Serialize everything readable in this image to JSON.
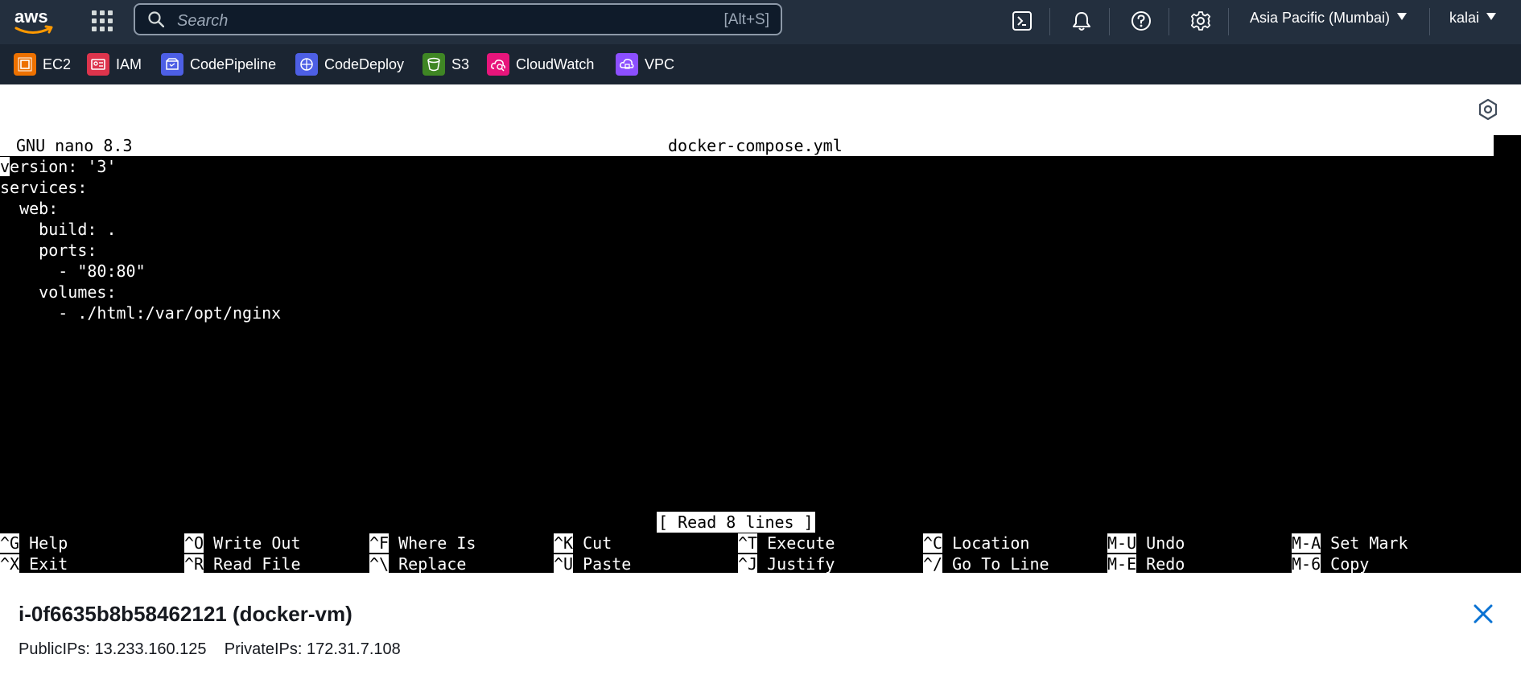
{
  "topbar": {
    "search_placeholder": "Search",
    "search_shortcut": "[Alt+S]",
    "region": "Asia Pacific (Mumbai)",
    "user": "kalai",
    "icons": [
      "cloudshell-icon",
      "bell-icon",
      "help-icon",
      "settings-icon"
    ]
  },
  "favorites": [
    {
      "label": "EC2",
      "color": "#ed7100"
    },
    {
      "label": "IAM",
      "color": "#dd344c"
    },
    {
      "label": "CodePipeline",
      "color": "#4d5fe5"
    },
    {
      "label": "CodeDeploy",
      "color": "#4d5fe5"
    },
    {
      "label": "S3",
      "color": "#3f8624"
    },
    {
      "label": "CloudWatch",
      "color": "#e7157b"
    },
    {
      "label": "VPC",
      "color": "#8c4fff"
    }
  ],
  "terminal": {
    "header_version": "GNU nano 8.3",
    "header_filename": "docker-compose.yml",
    "cursor_char": "v",
    "lines": [
      "ersion: '3'",
      "services:",
      "  web:",
      "    build: .",
      "    ports:",
      "      - \"80:80\"",
      "    volumes:",
      "      - ./html:/var/opt/nginx"
    ],
    "status_message": "[ Read 8 lines ]",
    "shortcuts": [
      {
        "key": "^G",
        "label": "Help"
      },
      {
        "key": "^O",
        "label": "Write Out"
      },
      {
        "key": "^F",
        "label": "Where Is"
      },
      {
        "key": "^K",
        "label": "Cut"
      },
      {
        "key": "^T",
        "label": "Execute"
      },
      {
        "key": "^C",
        "label": "Location"
      },
      {
        "key": "M-U",
        "label": "Undo"
      },
      {
        "key": "M-A",
        "label": "Set Mark"
      },
      {
        "key": "^X",
        "label": "Exit"
      },
      {
        "key": "^R",
        "label": "Read File"
      },
      {
        "key": "^\\",
        "label": "Replace"
      },
      {
        "key": "^U",
        "label": "Paste"
      },
      {
        "key": "^J",
        "label": "Justify"
      },
      {
        "key": "^/",
        "label": "Go To Line"
      },
      {
        "key": "M-E",
        "label": "Redo"
      },
      {
        "key": "M-6",
        "label": "Copy"
      }
    ]
  },
  "instance": {
    "title": "i-0f6635b8b58462121 (docker-vm)",
    "ips": "PublicIPs: 13.233.160.125    PrivateIPs: 172.31.7.108"
  }
}
